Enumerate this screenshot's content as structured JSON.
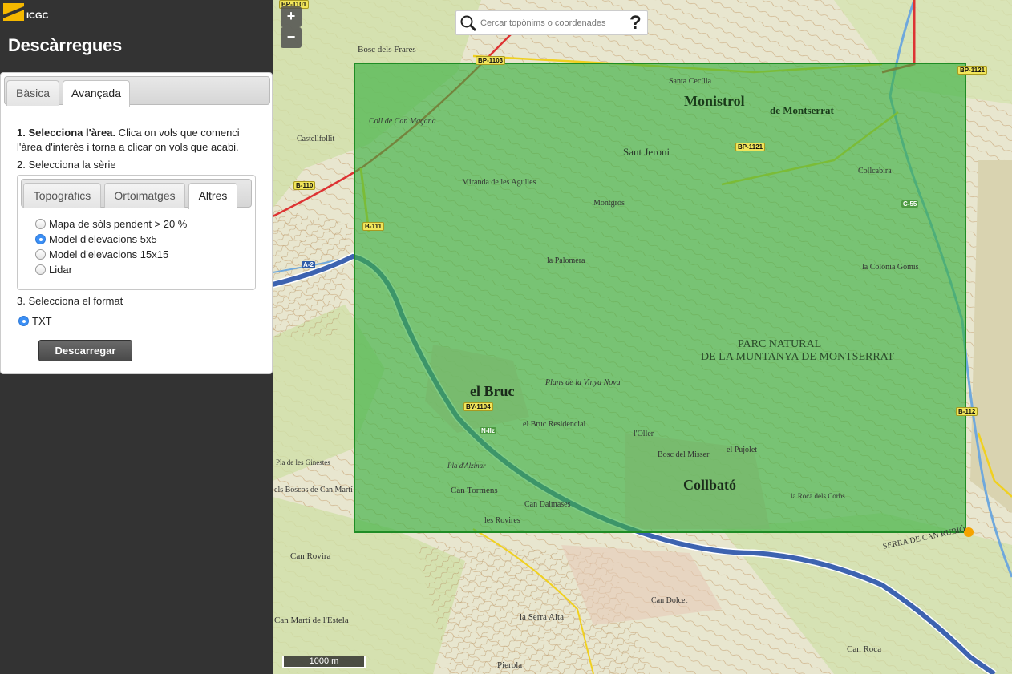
{
  "app": {
    "logo_text": "ICGC",
    "title": "Descàrregues"
  },
  "tabs": [
    {
      "label": "Bàsica",
      "active": false
    },
    {
      "label": "Avançada",
      "active": true
    }
  ],
  "steps": {
    "step1_bold": "1. Selecciona l'àrea.",
    "step1_text": " Clica on vols que comenci l'àrea d'interès i torna a clicar on vols que acabi.",
    "step2": "2. Selecciona la sèrie",
    "step3": "3. Selecciona el format"
  },
  "series_tabs": [
    {
      "label": "Topogràfics",
      "active": false
    },
    {
      "label": "Ortoimatges",
      "active": false
    },
    {
      "label": "Altres",
      "active": true
    }
  ],
  "series_options": [
    {
      "label": "Mapa de sòls pendent > 20 %",
      "selected": false
    },
    {
      "label": "Model d'elevacions 5x5",
      "selected": true
    },
    {
      "label": "Model d'elevacions 15x15",
      "selected": false
    },
    {
      "label": "Lidar",
      "selected": false
    }
  ],
  "format_options": [
    {
      "label": "TXT",
      "selected": true
    }
  ],
  "download_button": "Descarregar",
  "map": {
    "zoom_in": "+",
    "zoom_out": "−",
    "search_placeholder": "Cercar topònims o coordenades",
    "search_icon": "search-icon",
    "help_label": "?",
    "scale_label": "1000 m",
    "selection_color": "#3cb043",
    "place_labels": {
      "monistrol": "Monistrol",
      "monistrol2": "de Montserrat",
      "parc1": "PARC NATURAL",
      "parc2": "DE LA MUNTANYA DE MONTSERRAT",
      "elbruc": "el Bruc",
      "collbato": "Collbató",
      "santjeroni": "Sant Jeroni",
      "boscfrares": "Bosc dels Frares",
      "cantormens": "Can Tormens",
      "candalmases": "Can Dalmases",
      "lesrovires": "les Rovires",
      "canrovira": "Can Rovira",
      "cammartiestela": "Can Martí de l'Estela",
      "serraalta": "la Serra Alta",
      "pierola": "Pierola",
      "candolcet": "Can Dolcet",
      "canroca": "Can Roca",
      "coldecanmaçana": "Coll de Can Maçana",
      "castellfollit": "Castellfollit",
      "lapalomera": "la Palomera",
      "brucresidencial": "el Bruc Residencial",
      "loller": "l'Oller",
      "boscmisser": "Bosc del Misser",
      "plansvinya": "Plans de la Vinya Nova",
      "pujolet": "el Pujolet",
      "cangomis": "la Colònia Gomis",
      "collcabira": "Collcabira",
      "santacecilia": "Santa Cecília",
      "mirandaaguilers": "Miranda de les Agulles",
      "montgros": "Montgròs",
      "boscosmarti": "els Boscos de Can Martí",
      "cangrinestes": "Pla de les Ginestes",
      "pladalzinar": "Pla d'Alzinar",
      "laroca": "la Roca dels Corbs",
      "serradecanrubio": "SERRA DE CAN RUBIÓ"
    },
    "road_labels": {
      "bp1101": "BP-1101",
      "bp1103": "BP-1103",
      "bp1121": "BP-1121",
      "bp1121b": "BP-1121",
      "b110": "B-110",
      "b111": "B-111",
      "a2": "A-2",
      "c55": "C-55",
      "bv1104": "BV-1104",
      "b112": "B-112",
      "c1411": "N-IIz"
    }
  }
}
